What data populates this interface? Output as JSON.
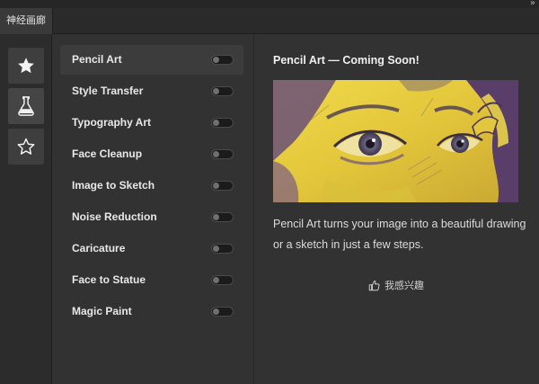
{
  "window": {
    "tab_title": "神经画廊",
    "collapse_glyph": "»"
  },
  "rail": {
    "items": [
      {
        "icon": "star-filled-icon",
        "state": "active"
      },
      {
        "icon": "flask-icon",
        "state": "selected"
      },
      {
        "icon": "star-outline-icon",
        "state": "normal"
      }
    ]
  },
  "filters": {
    "items": [
      {
        "label": "Pencil Art",
        "enabled": false
      },
      {
        "label": "Style Transfer",
        "enabled": false
      },
      {
        "label": "Typography Art",
        "enabled": false
      },
      {
        "label": "Face Cleanup",
        "enabled": false
      },
      {
        "label": "Image to Sketch",
        "enabled": false
      },
      {
        "label": "Noise Reduction",
        "enabled": false
      },
      {
        "label": "Caricature",
        "enabled": false
      },
      {
        "label": "Face to Statue",
        "enabled": false
      },
      {
        "label": "Magic Paint",
        "enabled": false
      }
    ],
    "selected": "Pencil Art"
  },
  "detail": {
    "title": "Pencil Art — Coming Soon!",
    "description": "Pencil Art turns your image into a beautiful drawing or a sketch in just a few steps.",
    "interest_label": "我感兴趣",
    "interest_icon": "thumbs-up-icon"
  },
  "colors": {
    "background": "#323232",
    "preview_yellow": "#e7cf3a",
    "preview_purple": "#5a3e6a"
  }
}
